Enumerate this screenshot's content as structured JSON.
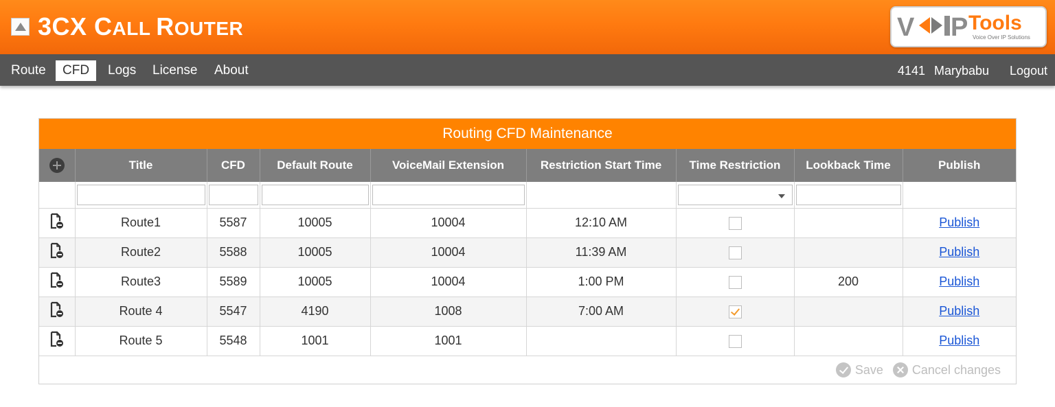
{
  "app": {
    "title_first": "3CX ",
    "title_c": "C",
    "title_all": "ALL ",
    "title_r": "R",
    "title_outer": "OUTER"
  },
  "logo": {
    "v": "V",
    "p": "P",
    "tools": "Tools",
    "tagline": "Voice Over IP Solutions"
  },
  "nav": {
    "items": [
      {
        "label": "Route"
      },
      {
        "label": "CFD",
        "active": true
      },
      {
        "label": "Logs"
      },
      {
        "label": "License"
      },
      {
        "label": "About"
      }
    ],
    "user_ext": "4141",
    "user_name": "Marybabu",
    "logout": "Logout"
  },
  "grid": {
    "title": "Routing CFD Maintenance",
    "columns": [
      "Title",
      "CFD",
      "Default Route",
      "VoiceMail Extension",
      "Restriction Start Time",
      "Time Restriction",
      "Lookback Time",
      "Publish"
    ],
    "rows": [
      {
        "title": "Route1",
        "cfd": "5587",
        "default_route": "10005",
        "voicemail": "10004",
        "start_time": "12:10 AM",
        "time_restriction": false,
        "lookback": "",
        "publish": "Publish"
      },
      {
        "title": "Route2",
        "cfd": "5588",
        "default_route": "10005",
        "voicemail": "10004",
        "start_time": "11:39 AM",
        "time_restriction": false,
        "lookback": "",
        "publish": "Publish"
      },
      {
        "title": "Route3",
        "cfd": "5589",
        "default_route": "10005",
        "voicemail": "10004",
        "start_time": "1:00 PM",
        "time_restriction": false,
        "lookback": "200",
        "publish": "Publish"
      },
      {
        "title": "Route 4",
        "cfd": "5547",
        "default_route": "4190",
        "voicemail": "1008",
        "start_time": "7:00 AM",
        "time_restriction": true,
        "lookback": "",
        "publish": "Publish"
      },
      {
        "title": "Route 5",
        "cfd": "5548",
        "default_route": "1001",
        "voicemail": "1001",
        "start_time": "",
        "time_restriction": false,
        "lookback": "",
        "publish": "Publish"
      }
    ],
    "save_label": "Save",
    "cancel_label": "Cancel changes"
  },
  "colors": {
    "header_orange": "#ff7a10",
    "nav_gray": "#555555",
    "grid_orange": "#ff8300",
    "column_gray": "#7e7e7e",
    "link_blue": "#1a56d6",
    "check_orange": "#f39a2c"
  }
}
